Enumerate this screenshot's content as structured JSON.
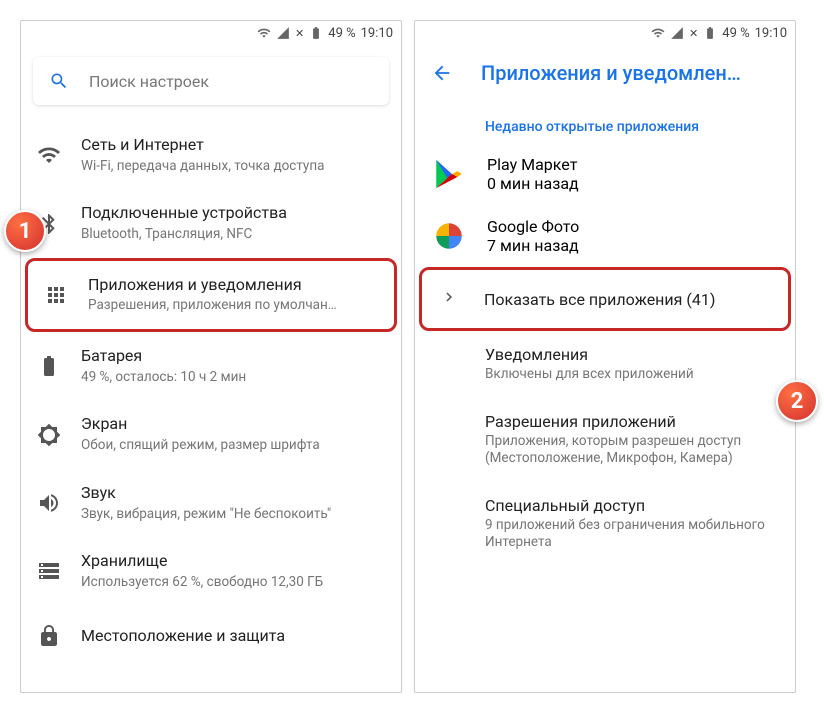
{
  "status": {
    "battery": "49 %",
    "time": "19:10"
  },
  "left": {
    "search_placeholder": "Поиск настроек",
    "items": [
      {
        "title": "Сеть и Интернет",
        "subtitle": "Wi-Fi, передача данных, точка доступа"
      },
      {
        "title": "Подключенные устройства",
        "subtitle": "Bluetooth, Трансляция, NFC"
      },
      {
        "title": "Приложения и уведомления",
        "subtitle": "Разрешения, приложения по умолчан…"
      },
      {
        "title": "Батарея",
        "subtitle": "49 %, осталось: 10 ч 2 мин"
      },
      {
        "title": "Экран",
        "subtitle": "Обои, спящий режим, размер шрифта"
      },
      {
        "title": "Звук",
        "subtitle": "Звук, вибрация, режим \"Не беспокоить\""
      },
      {
        "title": "Хранилище",
        "subtitle": "Используется 62 %, свободно 12,30 ГБ"
      },
      {
        "title": "Местоположение и защита",
        "subtitle": ""
      }
    ]
  },
  "right": {
    "app_title": "Приложения и уведомлен…",
    "section_header": "Недавно открытые приложения",
    "recent": [
      {
        "name": "Play Маркет",
        "time": "0 мин назад"
      },
      {
        "name": "Google Фото",
        "time": "7 мин назад"
      }
    ],
    "show_all": "Показать все приложения (41)",
    "prefs": [
      {
        "title": "Уведомления",
        "subtitle": "Включены для всех приложений"
      },
      {
        "title": "Разрешения приложений",
        "subtitle": "Приложения, которым разрешен доступ (Местоположение, Микрофон, Камера)"
      },
      {
        "title": "Специальный доступ",
        "subtitle": "9 приложений без ограничения мобильного Интернета"
      }
    ]
  },
  "badges": {
    "b1": "1",
    "b2": "2"
  }
}
